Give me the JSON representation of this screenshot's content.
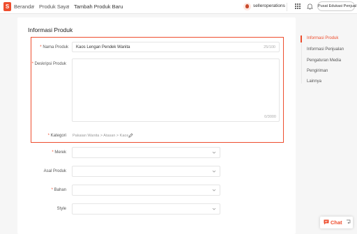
{
  "topbar": {
    "breadcrumb": [
      "Beranda",
      "Produk Saya",
      "Tambah Produk Baru"
    ],
    "username": "selleroperations",
    "edu_button": "Pusat Edukasi Penjual"
  },
  "form": {
    "section_title": "Informasi Produk",
    "name": {
      "label": "Nama Produk",
      "value": "Kaos Lengan Pendek Wanita",
      "counter": "25/100"
    },
    "description": {
      "label": "Deskripsi Produk",
      "value": "",
      "counter": "0/3000"
    },
    "category": {
      "label": "Kategori",
      "value": "Pakaian Wanita > Atasan > Kaos"
    },
    "attributes": [
      {
        "label": "Merek",
        "required": "*",
        "value": ""
      },
      {
        "label": "Asal Produk",
        "required": "",
        "value": ""
      },
      {
        "label": "Bahan",
        "required": "*",
        "value": ""
      },
      {
        "label": "Style",
        "required": "",
        "value": ""
      }
    ]
  },
  "side_nav": {
    "items": [
      "Informasi Produk",
      "Informasi Penjualan",
      "Pengaturan Media",
      "Pengiriman",
      "Lainnya"
    ],
    "active_index": 0
  },
  "chat": {
    "label": "Chat"
  },
  "colors": {
    "accent": "#ee4d2d",
    "background": "#f6f6f6"
  },
  "icons": [
    "shopee-logo-icon",
    "grid-icon",
    "bell-icon",
    "pencil-icon",
    "chevron-down-icon",
    "chat-icon"
  ]
}
